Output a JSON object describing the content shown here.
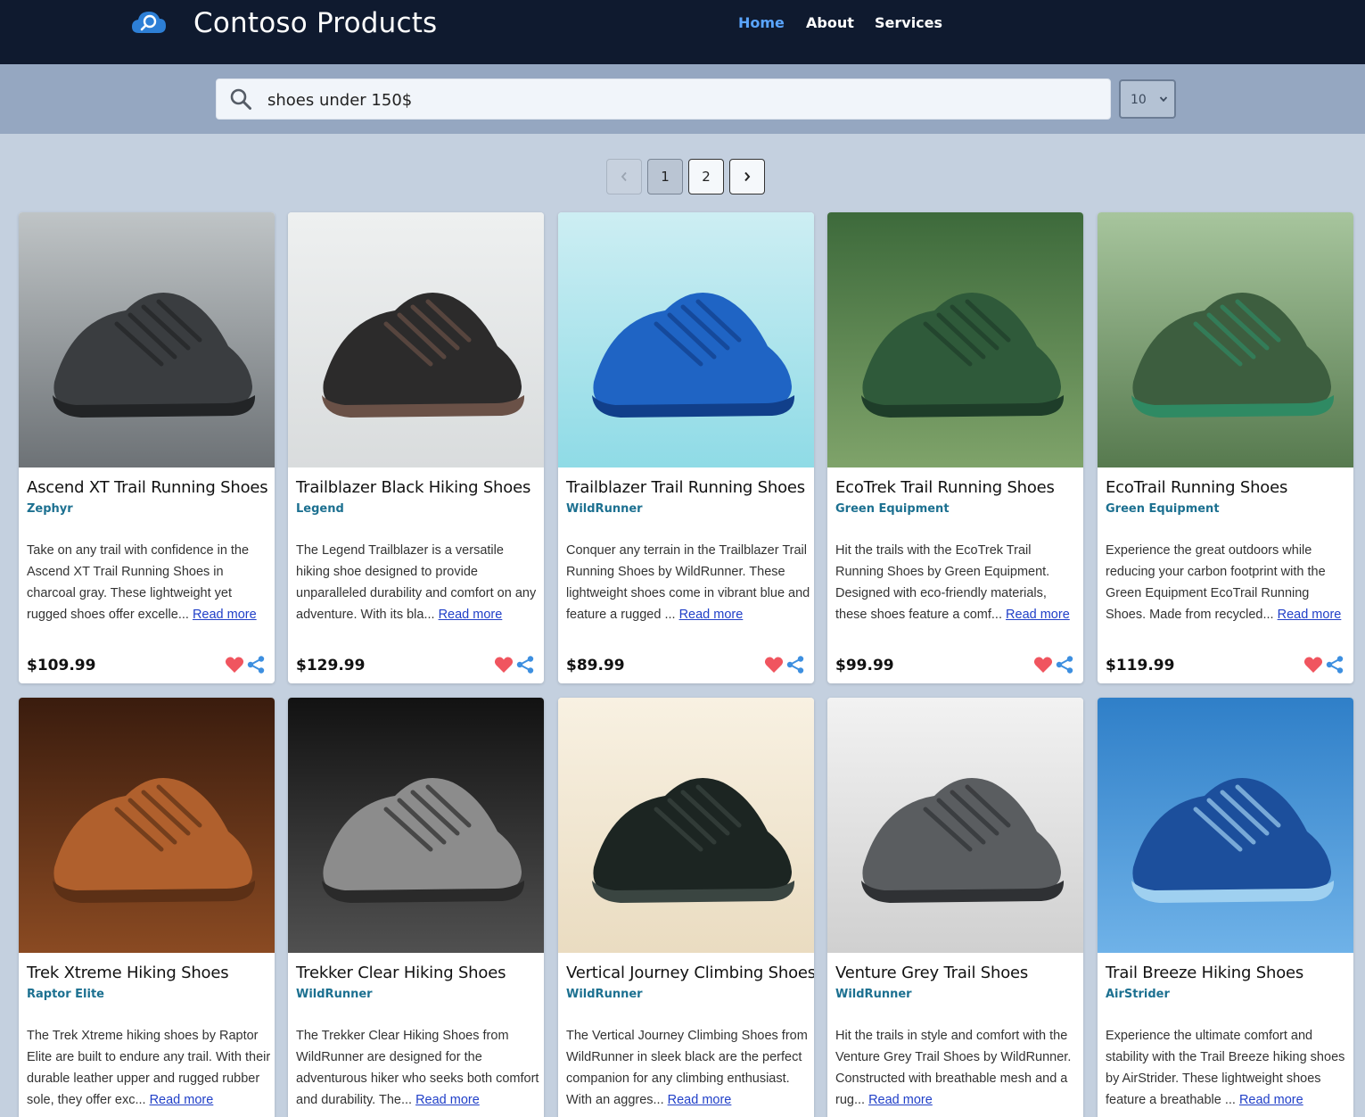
{
  "header": {
    "brand": "Contoso Products",
    "nav": [
      {
        "label": "Home",
        "active": true
      },
      {
        "label": "About",
        "active": false
      },
      {
        "label": "Services",
        "active": false
      }
    ]
  },
  "search": {
    "value": "shoes under 150$",
    "page_size": "10"
  },
  "pager": {
    "prev": "‹",
    "pages": [
      "1",
      "2"
    ],
    "current": "1",
    "next": "›"
  },
  "products": [
    {
      "title": "Ascend XT Trail Running Shoes",
      "brand": "Zephyr",
      "desc": "Take on any trail with confidence in the Ascend XT Trail Running Shoes in charcoal gray. These lightweight yet rugged shoes offer excelle...",
      "read_more": "Read more",
      "price": "$109.99",
      "image": "charcoal-trail-shoe"
    },
    {
      "title": "Trailblazer Black Hiking Shoes",
      "brand": "Legend",
      "desc": "The Legend Trailblazer is a versatile hiking shoe designed to provide unparalleled durability and comfort on any adventure. With its bla...",
      "read_more": "Read more",
      "price": "$129.99",
      "image": "black-hiking-shoe"
    },
    {
      "title": "Trailblazer Trail Running Shoes",
      "brand": "WildRunner",
      "desc": "Conquer any terrain in the Trailblazer Trail Running Shoes by WildRunner. These lightweight shoes come in vibrant blue and feature a rugged ...",
      "read_more": "Read more",
      "price": "$89.99",
      "image": "blue-running-shoe"
    },
    {
      "title": "EcoTrek Trail Running Shoes",
      "brand": "Green Equipment",
      "desc": "Hit the trails with the EcoTrek Trail Running Shoes by Green Equipment. Designed with eco-friendly materials, these shoes feature a comf...",
      "read_more": "Read more",
      "price": "$99.99",
      "image": "green-trail-shoe"
    },
    {
      "title": "EcoTrail Running Shoes",
      "brand": "Green Equipment",
      "desc": "Experience the great outdoors while reducing your carbon footprint with the Green Equipment EcoTrail Running Shoes. Made from recycled...",
      "read_more": "Read more",
      "price": "$119.99",
      "image": "green-running-shoe"
    },
    {
      "title": "Trek Xtreme Hiking Shoes",
      "brand": "Raptor Elite",
      "desc": "The Trek Xtreme hiking shoes by Raptor Elite are built to endure any trail. With their durable leather upper and rugged rubber sole, they offer exc...",
      "read_more": "Read more",
      "price": "",
      "image": "brown-leather-boot"
    },
    {
      "title": "Trekker Clear Hiking Shoes",
      "brand": "WildRunner",
      "desc": "The Trekker Clear Hiking Shoes from WildRunner are designed for the adventurous hiker who seeks both comfort and durability. The...",
      "read_more": "Read more",
      "price": "",
      "image": "clear-hiking-boot"
    },
    {
      "title": "Vertical Journey Climbing Shoes",
      "brand": "WildRunner",
      "desc": "The Vertical Journey Climbing Shoes from WildRunner in sleek black are the perfect companion for any climbing enthusiast. With an aggres...",
      "read_more": "Read more",
      "price": "",
      "image": "black-climbing-shoe"
    },
    {
      "title": "Venture Grey Trail Shoes",
      "brand": "WildRunner",
      "desc": "Hit the trails in style and comfort with the Venture Grey Trail Shoes by WildRunner. Constructed with breathable mesh and a rug...",
      "read_more": "Read more",
      "price": "",
      "image": "grey-trail-shoe"
    },
    {
      "title": "Trail Breeze Hiking Shoes",
      "brand": "AirStrider",
      "desc": "Experience the ultimate comfort and stability with the Trail Breeze hiking shoes by AirStrider. These lightweight shoes feature a breathable ...",
      "read_more": "Read more",
      "price": "",
      "image": "blue-hiking-shoe"
    }
  ]
}
